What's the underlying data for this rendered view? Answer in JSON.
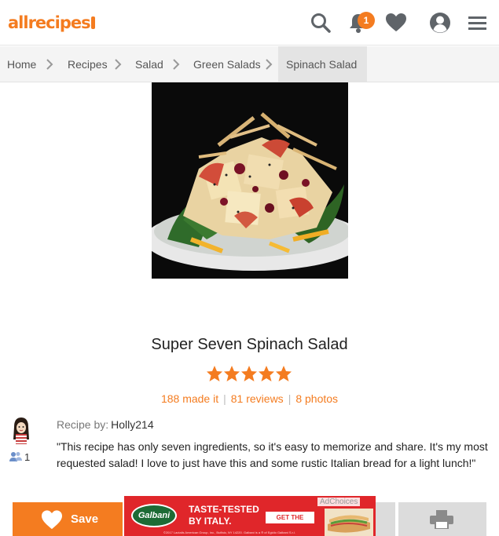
{
  "header": {
    "logo_text": "allrecipes",
    "notification_count": "1",
    "icons": [
      "search-icon",
      "bell-icon",
      "heart-icon",
      "user-icon",
      "menu-icon"
    ],
    "brand_color": "#f47c20"
  },
  "breadcrumb": {
    "items": [
      "Home",
      "Recipes",
      "Salad",
      "Green Salads",
      "Spinach Salad"
    ]
  },
  "recipe": {
    "title": "Super Seven Spinach Salad",
    "rating_stars": 5,
    "made_it": "188 made it",
    "reviews": "81 reviews",
    "photos": "8 photos",
    "separator": "|",
    "author_label": "Recipe by:",
    "author_name": "Holly214",
    "followers": "1",
    "description": "\"This recipe has only seven ingredients, so it's easy to memorize and share. It's my most requested salad! I love to just have this and some rustic Italian bread for a light lunch!\""
  },
  "bottom_bar": {
    "save_label": "Save",
    "ad": {
      "brand": "Galbani",
      "headline_1": "TASTE-TESTED",
      "headline_2": "BY ITALY.",
      "cta": "GET THE RECIPE ▸",
      "ad_choices": "AdChoices",
      "fine_print": "©2017 Lactalis American Group, Inc., Buffalo, NY 14220. Galbani is a ® of Egidio Galbani S.r.l."
    }
  }
}
